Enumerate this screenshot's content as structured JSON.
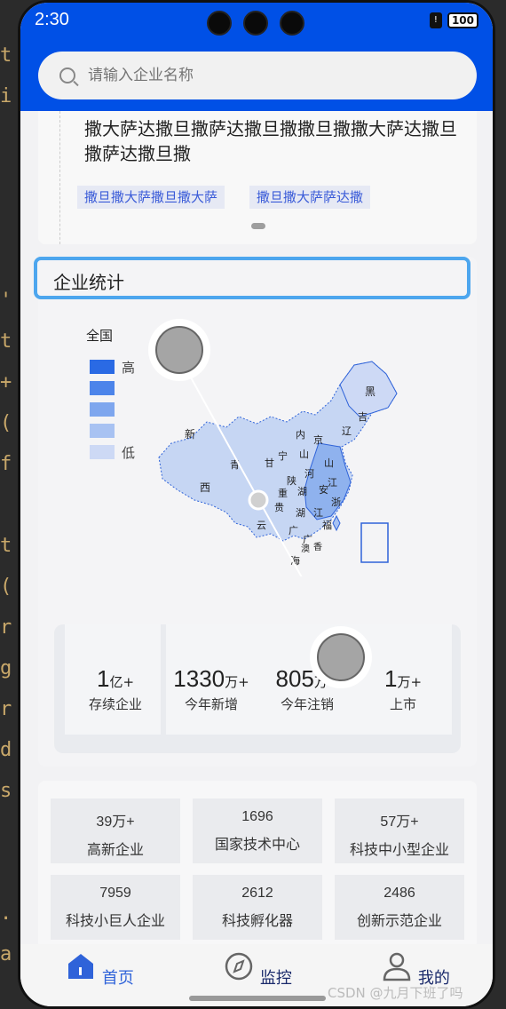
{
  "status": {
    "time": "2:30",
    "battery": "100"
  },
  "search": {
    "placeholder": "请输入企业名称"
  },
  "news": {
    "title": "撒大萨达撒旦撒萨达撒旦撒撒旦撒撒大萨达撒旦撒萨达撒旦撒",
    "tags": [
      "撒旦撒大萨撒旦撒大萨",
      "撒旦撒大萨萨达撒"
    ]
  },
  "stats": {
    "title": "企业统计",
    "map": {
      "region": "全国",
      "legend_high": "高",
      "legend_low": "低",
      "legend_colors": [
        "#2a6ae4",
        "#4c84ea",
        "#7ea6ee",
        "#a8c2f2",
        "#cdd9f5"
      ],
      "provinces": [
        "黑",
        "吉",
        "辽",
        "新",
        "内",
        "京",
        "山",
        "甘",
        "宁",
        "青",
        "河",
        "山",
        "江",
        "西",
        "陕",
        "湖",
        "安",
        "浙",
        "贵",
        "湖",
        "江",
        "云",
        "广",
        "福",
        "广",
        "澳",
        "香",
        "海",
        "四",
        "重",
        "台"
      ]
    },
    "metrics": [
      {
        "value": "1",
        "unit": "亿+",
        "label": "存续企业"
      },
      {
        "value": "1330",
        "unit": "万+",
        "label": "今年新增"
      },
      {
        "value": "805",
        "unit": "万+",
        "label": "今年注销"
      },
      {
        "value": "1",
        "unit": "万+",
        "label": "上市"
      }
    ]
  },
  "grid": [
    {
      "value": "39万+",
      "label": "高新企业"
    },
    {
      "value": "1696",
      "label": "国家技术中心"
    },
    {
      "value": "57万+",
      "label": "科技中小型企业"
    },
    {
      "value": "7959",
      "label": "科技小巨人企业"
    },
    {
      "value": "2612",
      "label": "科技孵化器"
    },
    {
      "value": "2486",
      "label": "创新示范企业"
    }
  ],
  "tabs": [
    {
      "label": "首页",
      "icon": "home-icon",
      "active": true
    },
    {
      "label": "监控",
      "icon": "compass-icon",
      "active": false
    },
    {
      "label": "我的",
      "icon": "user-icon",
      "active": false
    }
  ],
  "watermark": "CSDN @九月下班了吗",
  "colors": {
    "primary": "#0050e6",
    "accent": "#2f63d9",
    "highlight": "#4da6ee"
  }
}
